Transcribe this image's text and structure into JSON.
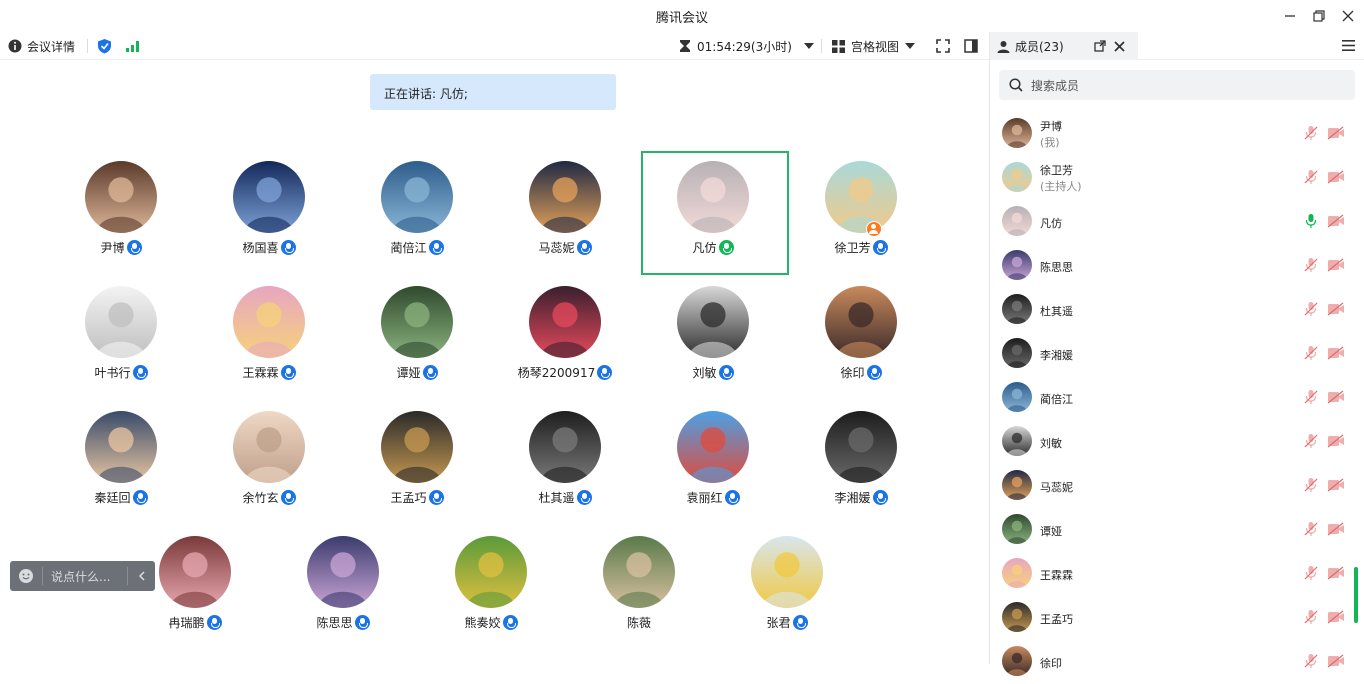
{
  "window": {
    "title": "腾讯会议"
  },
  "toolbar": {
    "meeting_info": "会议详情",
    "timer": "01:54:29(3小时)",
    "view_mode": "宫格视图"
  },
  "speaking": {
    "text": "正在讲话: 凡仿;"
  },
  "participants": [
    {
      "name": "尹博",
      "mic": "on"
    },
    {
      "name": "杨国喜",
      "mic": "on"
    },
    {
      "name": "蔺倍江",
      "mic": "on"
    },
    {
      "name": "马蕊妮",
      "mic": "on"
    },
    {
      "name": "凡仿",
      "mic": "speaking"
    },
    {
      "name": "徐卫芳",
      "mic": "on"
    },
    {
      "name": "叶书行",
      "mic": "on"
    },
    {
      "name": "王霖霖",
      "mic": "on"
    },
    {
      "name": "谭娅",
      "mic": "on"
    },
    {
      "name": "杨琴2200917",
      "mic": "on"
    },
    {
      "name": "刘敏",
      "mic": "on"
    },
    {
      "name": "徐印",
      "mic": "on"
    },
    {
      "name": "秦廷回",
      "mic": "on"
    },
    {
      "name": "余竹玄",
      "mic": "on"
    },
    {
      "name": "王孟巧",
      "mic": "on"
    },
    {
      "name": "杜其遥",
      "mic": "on"
    },
    {
      "name": "袁丽红",
      "mic": "on"
    },
    {
      "name": "李湘媛",
      "mic": "on"
    },
    {
      "name": "冉瑞鹏",
      "mic": "on"
    },
    {
      "name": "陈思思",
      "mic": "on"
    },
    {
      "name": "熊奏姣",
      "mic": "on"
    },
    {
      "name": "陈薇",
      "mic": "none"
    },
    {
      "name": "张君",
      "mic": "on"
    }
  ],
  "chat": {
    "placeholder": "说点什么..."
  },
  "panel": {
    "tab_label": "成员(23)",
    "search_placeholder": "搜索成员",
    "members": [
      {
        "name": "尹博",
        "sub": "(我)"
      },
      {
        "name": "徐卫芳",
        "sub": "(主持人)"
      },
      {
        "name": "凡仿",
        "sub": "",
        "speaking": true
      },
      {
        "name": "陈思思",
        "sub": ""
      },
      {
        "name": "杜其遥",
        "sub": ""
      },
      {
        "name": "李湘媛",
        "sub": ""
      },
      {
        "name": "蔺倍江",
        "sub": ""
      },
      {
        "name": "刘敏",
        "sub": ""
      },
      {
        "name": "马蕊妮",
        "sub": ""
      },
      {
        "name": "谭娅",
        "sub": ""
      },
      {
        "name": "王霖霖",
        "sub": ""
      },
      {
        "name": "王孟巧",
        "sub": ""
      },
      {
        "name": "徐印",
        "sub": ""
      }
    ]
  },
  "colors": {
    "accent_blue": "#1a73e8",
    "speaking_green": "#13b559",
    "muted_red": "#e06b6b"
  },
  "avatars": {
    "grid": [
      [
        "#5a3a2a",
        "#e0b89a"
      ],
      [
        "#13285a",
        "#7fa3d8"
      ],
      [
        "#2e5d8c",
        "#8ab6d6"
      ],
      [
        "#1f2a44",
        "#e6a25a"
      ],
      [
        "#b7b1b4",
        "#f3d9d8"
      ],
      [
        "#a9d9d8",
        "#f2c98a"
      ],
      [
        "#f3f3f3",
        "#bfbfbf"
      ],
      [
        "#e7a6c1",
        "#f6d27a"
      ],
      [
        "#2f4a2e",
        "#8bb37f"
      ],
      [
        "#3a1f2e",
        "#e74a5c"
      ],
      [
        "#d8d8d8",
        "#2c2c2c"
      ],
      [
        "#c98a5c",
        "#3a2a2a"
      ],
      [
        "#394b6a",
        "#e9c6a2"
      ],
      [
        "#eed8c6",
        "#bfa08a"
      ],
      [
        "#2a2a2a",
        "#c79a52"
      ],
      [
        "#1e1e1e",
        "#7a7a7a"
      ],
      [
        "#4ba0e6",
        "#e24a3a"
      ],
      [
        "#1d1d1d",
        "#6a6a6a"
      ],
      [
        "#7a3a3a",
        "#e8a8b0"
      ],
      [
        "#3b3b6e",
        "#caa6d6"
      ],
      [
        "#5a9a3a",
        "#e0c040"
      ],
      [
        "#5a7a4a",
        "#d8c0a0"
      ],
      [
        "#d8e6ee",
        "#f0c840"
      ]
    ],
    "members": [
      [
        "#5a3a2a",
        "#e0b89a"
      ],
      [
        "#a9d9d8",
        "#f2c98a"
      ],
      [
        "#b7b1b4",
        "#f3d9d8"
      ],
      [
        "#3b3b6e",
        "#caa6d6"
      ],
      [
        "#1e1e1e",
        "#7a7a7a"
      ],
      [
        "#1d1d1d",
        "#6a6a6a"
      ],
      [
        "#2e5d8c",
        "#8ab6d6"
      ],
      [
        "#d8d8d8",
        "#2c2c2c"
      ],
      [
        "#1f2a44",
        "#e6a25a"
      ],
      [
        "#2f4a2e",
        "#8bb37f"
      ],
      [
        "#e7a6c1",
        "#f6d27a"
      ],
      [
        "#2a2a2a",
        "#c79a52"
      ],
      [
        "#c98a5c",
        "#3a2a2a"
      ]
    ]
  }
}
